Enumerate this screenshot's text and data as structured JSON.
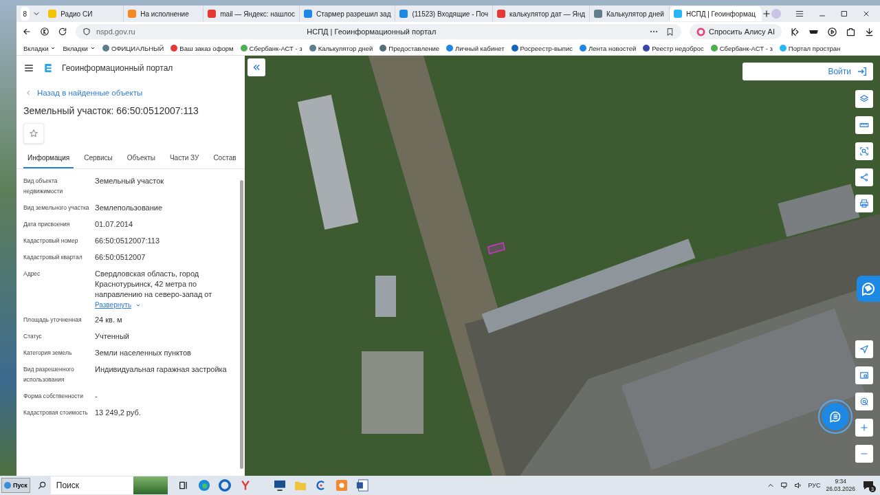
{
  "browser": {
    "tab_count": "8",
    "tabs": [
      {
        "title": "Радио СИ",
        "selected": false
      },
      {
        "title": "На исполнение",
        "selected": false
      },
      {
        "title": "mail — Яндекс: нашлос",
        "selected": false
      },
      {
        "title": "Стармер разрешил зад",
        "selected": false
      },
      {
        "title": "(11523) Входящие - Поч",
        "selected": false
      },
      {
        "title": "калькулятор дат — Янд",
        "selected": false
      },
      {
        "title": "Калькулятор дней",
        "selected": false
      },
      {
        "title": "НСПД | Геоинформац",
        "selected": true
      }
    ],
    "address": "nspd.gov.ru",
    "page_title": "НСПД | Геоинформационный портал",
    "alice_button": "Спросить Алису AI",
    "bookmarks": [
      "Вкладки",
      "Вкладки",
      "ОФИЦИАЛЬНЫЙ",
      "Ваш заказ оформ",
      "Сбербанк-АСТ - з",
      "Калькулятор дней",
      "Предоставление",
      "Личный кабинет",
      "Росреестр-выпис",
      "Лента новостей",
      "Реестр недоброс",
      "Сбербанк-АСТ - з",
      "Портал простран"
    ]
  },
  "portal": {
    "title": "Геоинформационный портал",
    "back_link": "Назад в найденные объекты",
    "heading": "Земельный участок: 66:50:0512007:113",
    "tabs": [
      {
        "label": "Информация",
        "selected": true
      },
      {
        "label": "Сервисы",
        "selected": false
      },
      {
        "label": "Объекты",
        "selected": false
      },
      {
        "label": "Части ЗУ",
        "selected": false
      },
      {
        "label": "Состав",
        "selected": false
      }
    ],
    "fields": [
      {
        "label": "Вид объекта недвижимости",
        "value": "Земельный участок"
      },
      {
        "label": "Вид земельного участка",
        "value": "Землепользование"
      },
      {
        "label": "Дата присвоения",
        "value": "01.07.2014"
      },
      {
        "label": "Кадастровый номер",
        "value": "66:50:0512007:113"
      },
      {
        "label": "Кадастровый квартал",
        "value": "66:50:0512007"
      },
      {
        "label": "Адрес",
        "value": "Свердловская область, город Краснотурьинск, 42 метра по направлению на северо-запад от",
        "expand_link": "Развернуть"
      },
      {
        "label": "Площадь уточненная",
        "value": "24 кв. м"
      },
      {
        "label": "Статус",
        "value": "Учтенный"
      },
      {
        "label": "Категория земель",
        "value": "Земли населенных пунктов"
      },
      {
        "label": "Вид разрешенного использования",
        "value": "Индивидуальная гаражная застройка"
      },
      {
        "label": "Форма собственности",
        "value": "-"
      },
      {
        "label": "Кадастровая стоимость",
        "value": "13 249,2 руб."
      }
    ]
  },
  "map": {
    "login_button": "Войти"
  },
  "taskbar": {
    "start": "Пуск",
    "search_placeholder": "Поиск",
    "language": "РУС",
    "time": "9:34",
    "date": "26.03.2026",
    "notifications": "3"
  }
}
